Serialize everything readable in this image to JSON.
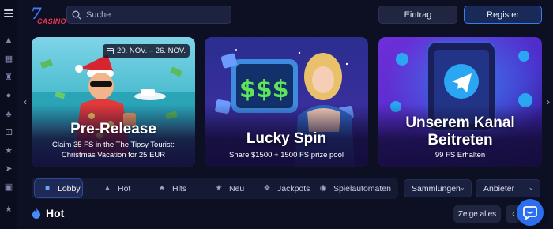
{
  "header": {
    "logo_number": "7",
    "logo_word": "CASINO",
    "search_placeholder": "Suche",
    "login_label": "Eintrag",
    "register_label": "Register"
  },
  "banners": [
    {
      "title": "Pre-Release",
      "subtitle_line1": "Claim 35 FS in the The Tipsy Tourist:",
      "subtitle_line2": "Christmas Vacation for 25 EUR",
      "date_badge": "20. NOV. – 26. NOV."
    },
    {
      "title": "Lucky Spin",
      "subtitle_line1": "Share $1500 + 1500 FS prize pool"
    },
    {
      "title_line1": "Unserem Kanal",
      "title_line2": "Beitreten",
      "subtitle_line1": "99 FS Erhalten"
    }
  ],
  "categories": [
    {
      "label": "Lobby",
      "icon": "lobby-icon",
      "active": true
    },
    {
      "label": "Hot",
      "icon": "fire-icon"
    },
    {
      "label": "Hits",
      "icon": "hits-icon"
    },
    {
      "label": "Neu",
      "icon": "new-icon"
    },
    {
      "label": "Jackpots",
      "icon": "jackpot-icon"
    },
    {
      "label": "Spielautomaten",
      "icon": "slots-icon"
    }
  ],
  "filters": {
    "collections_label": "Sammlungen",
    "providers_label": "Anbieter"
  },
  "hot_section": {
    "title": "Hot",
    "show_all_label": "Zeige alles"
  },
  "colors": {
    "background": "#0d1023",
    "accent": "#3a7bf1",
    "chat": "#2b6ff0"
  }
}
